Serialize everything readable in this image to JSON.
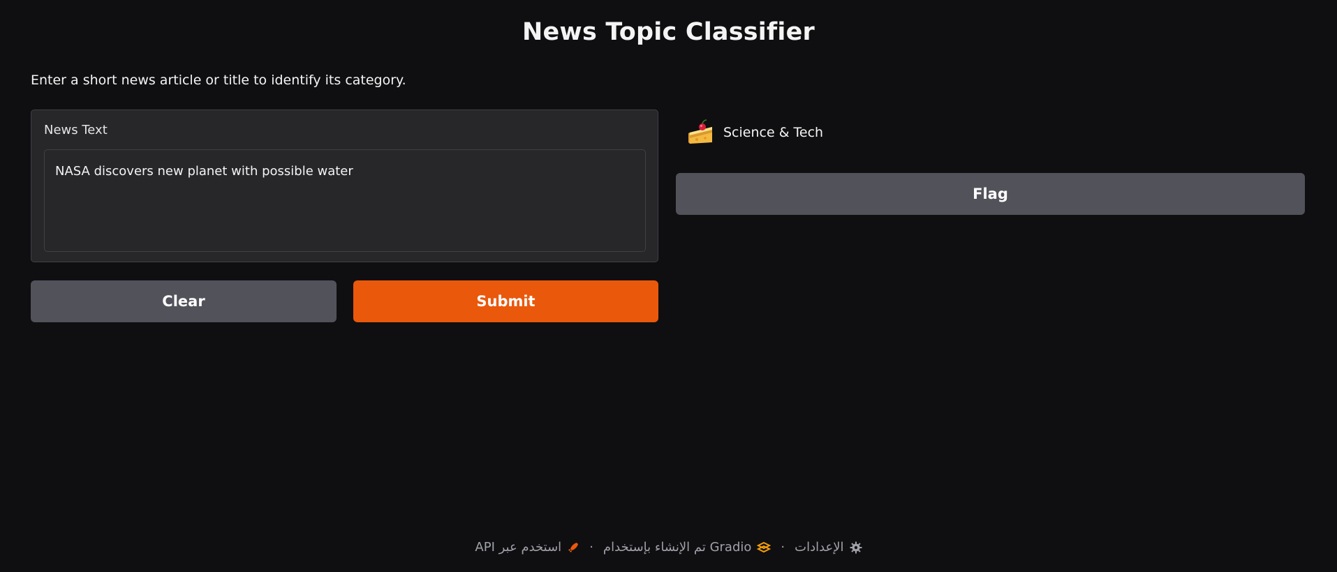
{
  "header": {
    "title": "News Topic Classifier",
    "description": "Enter a short news article or title to identify its category."
  },
  "input": {
    "label": "News Text",
    "value": "NASA discovers new planet with possible water"
  },
  "buttons": {
    "clear_label": "Clear",
    "submit_label": "Submit",
    "flag_label": "Flag"
  },
  "output": {
    "label": "Science & Tech",
    "icon": "cheese-cake-emoji-icon"
  },
  "footer": {
    "api_label": "API استخدم عبر",
    "built_with_label": "تم الإنشاء بإستخدام Gradio",
    "settings_label": "الإعدادات",
    "separator": "·"
  },
  "colors": {
    "background": "#0f0f11",
    "panel": "#27272a",
    "secondary_button": "#52525b",
    "primary_button": "#ea580c"
  }
}
